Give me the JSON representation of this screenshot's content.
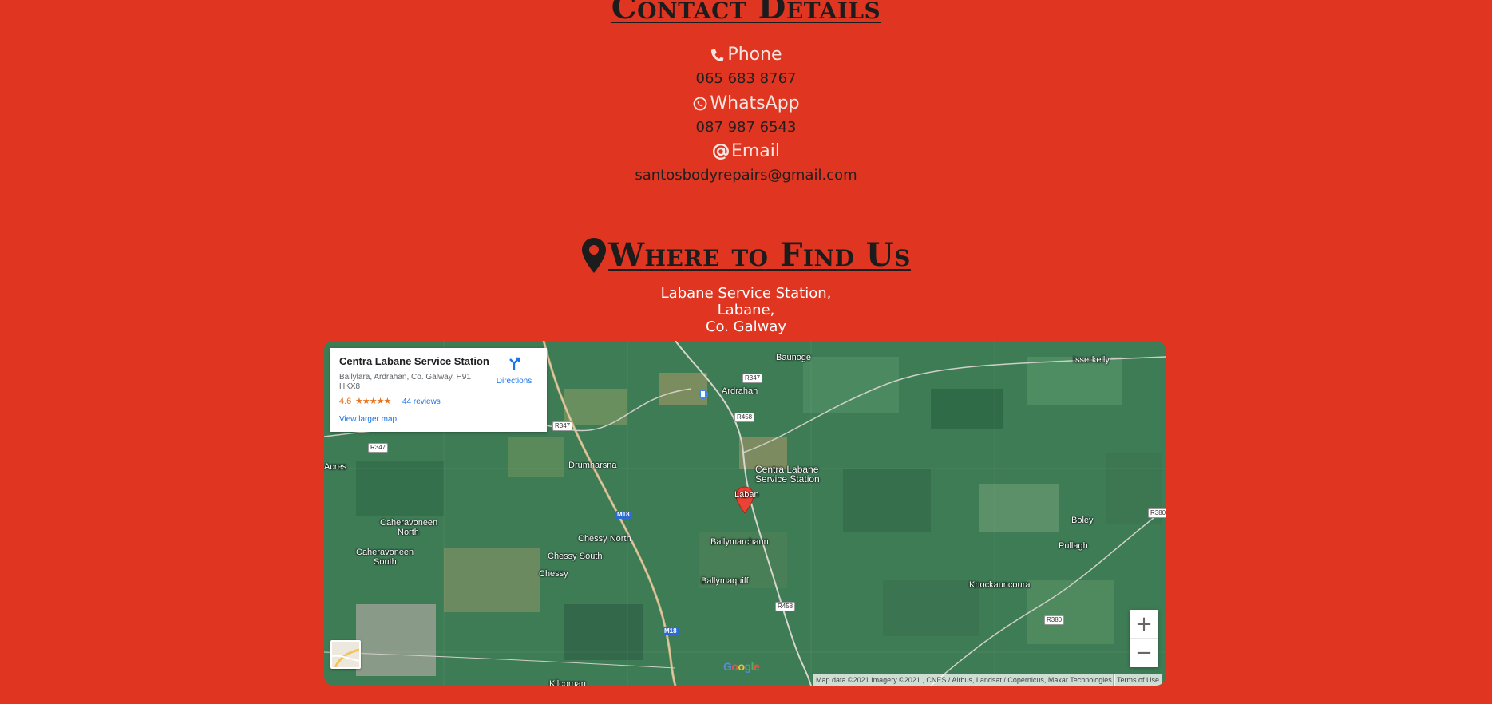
{
  "contact": {
    "title": "Contact Details",
    "phone": {
      "label": "Phone",
      "value": "065 683 8767"
    },
    "whatsapp": {
      "label": "WhatsApp",
      "value": "087 987 6543"
    },
    "email": {
      "label": "Email",
      "value": "santosbodyrepairs@gmail.com"
    }
  },
  "location": {
    "title": "Where to Find Us",
    "address_lines": [
      "Labane Service Station,",
      "Labane,",
      "Co. Galway"
    ]
  },
  "map": {
    "info_card": {
      "name": "Centra Labane Service Station",
      "address": "Ballylara, Ardrahan, Co. Galway, H91 HKX8",
      "rating": "4.6",
      "stars": "★★★★★",
      "reviews": "44 reviews",
      "larger_map": "View larger map",
      "directions": "Directions"
    },
    "pin_label_line1": "Centra Labane",
    "pin_label_line2": "Service Station",
    "places": {
      "baunoge": "Baunoge",
      "isserkelly": "Isserkelly",
      "ardrahan": "Ardrahan",
      "acres": "Acres",
      "drumharsna": "Drumharsna",
      "labane": "Laban",
      "caheravoneen_north_1": "Caheravoneen",
      "caheravoneen_north_2": "North",
      "caheravoneen_south_1": "Caheravoneen",
      "caheravoneen_south_2": "South",
      "chessy_north": "Chessy North",
      "chessy_south": "Chessy South",
      "chessy": "Chessy",
      "ballymarchaun": "Ballymarchaun",
      "ballymaquiff": "Ballymaquiff",
      "boley": "Boley",
      "pullagh": "Pullagh",
      "knockauncoura": "Knockauncoura",
      "kilcornan": "Kilcornan"
    },
    "roads": {
      "r347_a": "R347",
      "r347_b": "R347",
      "r347_c": "R347",
      "r458_a": "R458",
      "r458_b": "R458",
      "r380_a": "R380",
      "r380_b": "R380",
      "m18_a": "M18",
      "m18_b": "M18"
    },
    "zoom_in": "+",
    "zoom_out": "−",
    "attribution": "Map data ©2021 Imagery ©2021 , CNES / Airbus, Landsat / Copernicus, Maxar Technologies",
    "terms": "Terms of Use",
    "logo_letters": [
      "G",
      "o",
      "o",
      "g",
      "l",
      "e"
    ]
  },
  "colors": {
    "background": "#e03520",
    "heading": "#1c1c1c",
    "map_pin": "#ea4335"
  },
  "icons": [
    "phone-icon",
    "whatsapp-icon",
    "at-icon",
    "map-marker-icon",
    "directions-icon"
  ]
}
